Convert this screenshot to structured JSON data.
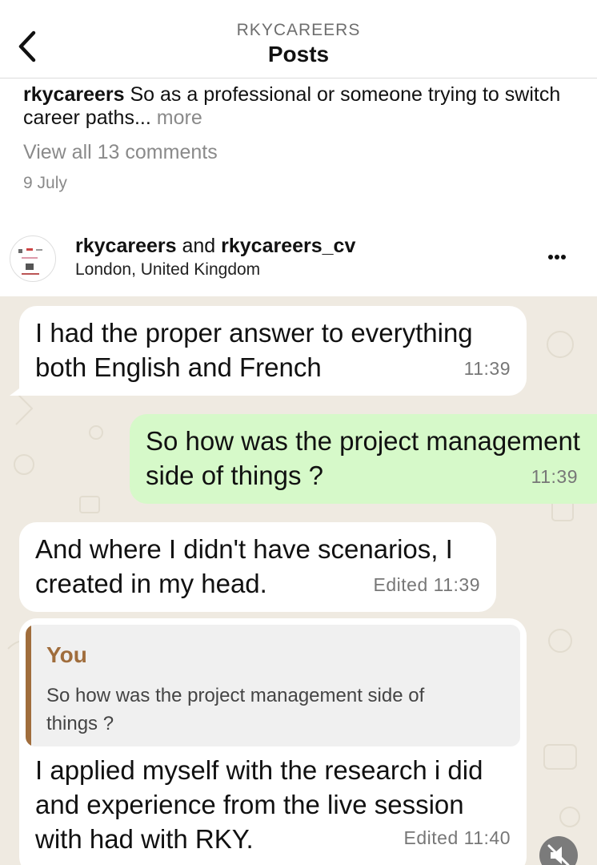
{
  "header": {
    "account": "RKYCAREERS",
    "title": "Posts"
  },
  "caption": {
    "username": "rkycareers",
    "text": "So as a professional or someone trying to switch career paths...",
    "more_label": "more"
  },
  "comments_link": "View all 13 comments",
  "date": "9 July",
  "post": {
    "user1": "rkycareers",
    "joiner": " and ",
    "user2": "rkycareers_cv",
    "location": "London, United Kingdom"
  },
  "messages": [
    {
      "direction": "incoming",
      "text": "I had the proper answer to everything both English and French",
      "time": "11:39"
    },
    {
      "direction": "outgoing",
      "text": "So how was the project management side of things ?",
      "time": "11:39"
    },
    {
      "direction": "incoming",
      "text": "And where I didn't have scenarios, I created in my head.",
      "time": "Edited 11:39"
    },
    {
      "direction": "incoming",
      "quote": {
        "author": "You",
        "text": "So how was the project management side of things ?"
      },
      "text": "I applied myself with the research i did and experience from the live session with had with RKY.",
      "time": "Edited 11:40"
    }
  ],
  "colors": {
    "chat_background": "#efeae1",
    "incoming_bubble": "#ffffff",
    "outgoing_bubble": "#d6f9c9",
    "quote_accent": "#a06d3c"
  },
  "icons": [
    "chevron-left-icon",
    "more-horizontal-icon",
    "speaker-muted-icon"
  ]
}
